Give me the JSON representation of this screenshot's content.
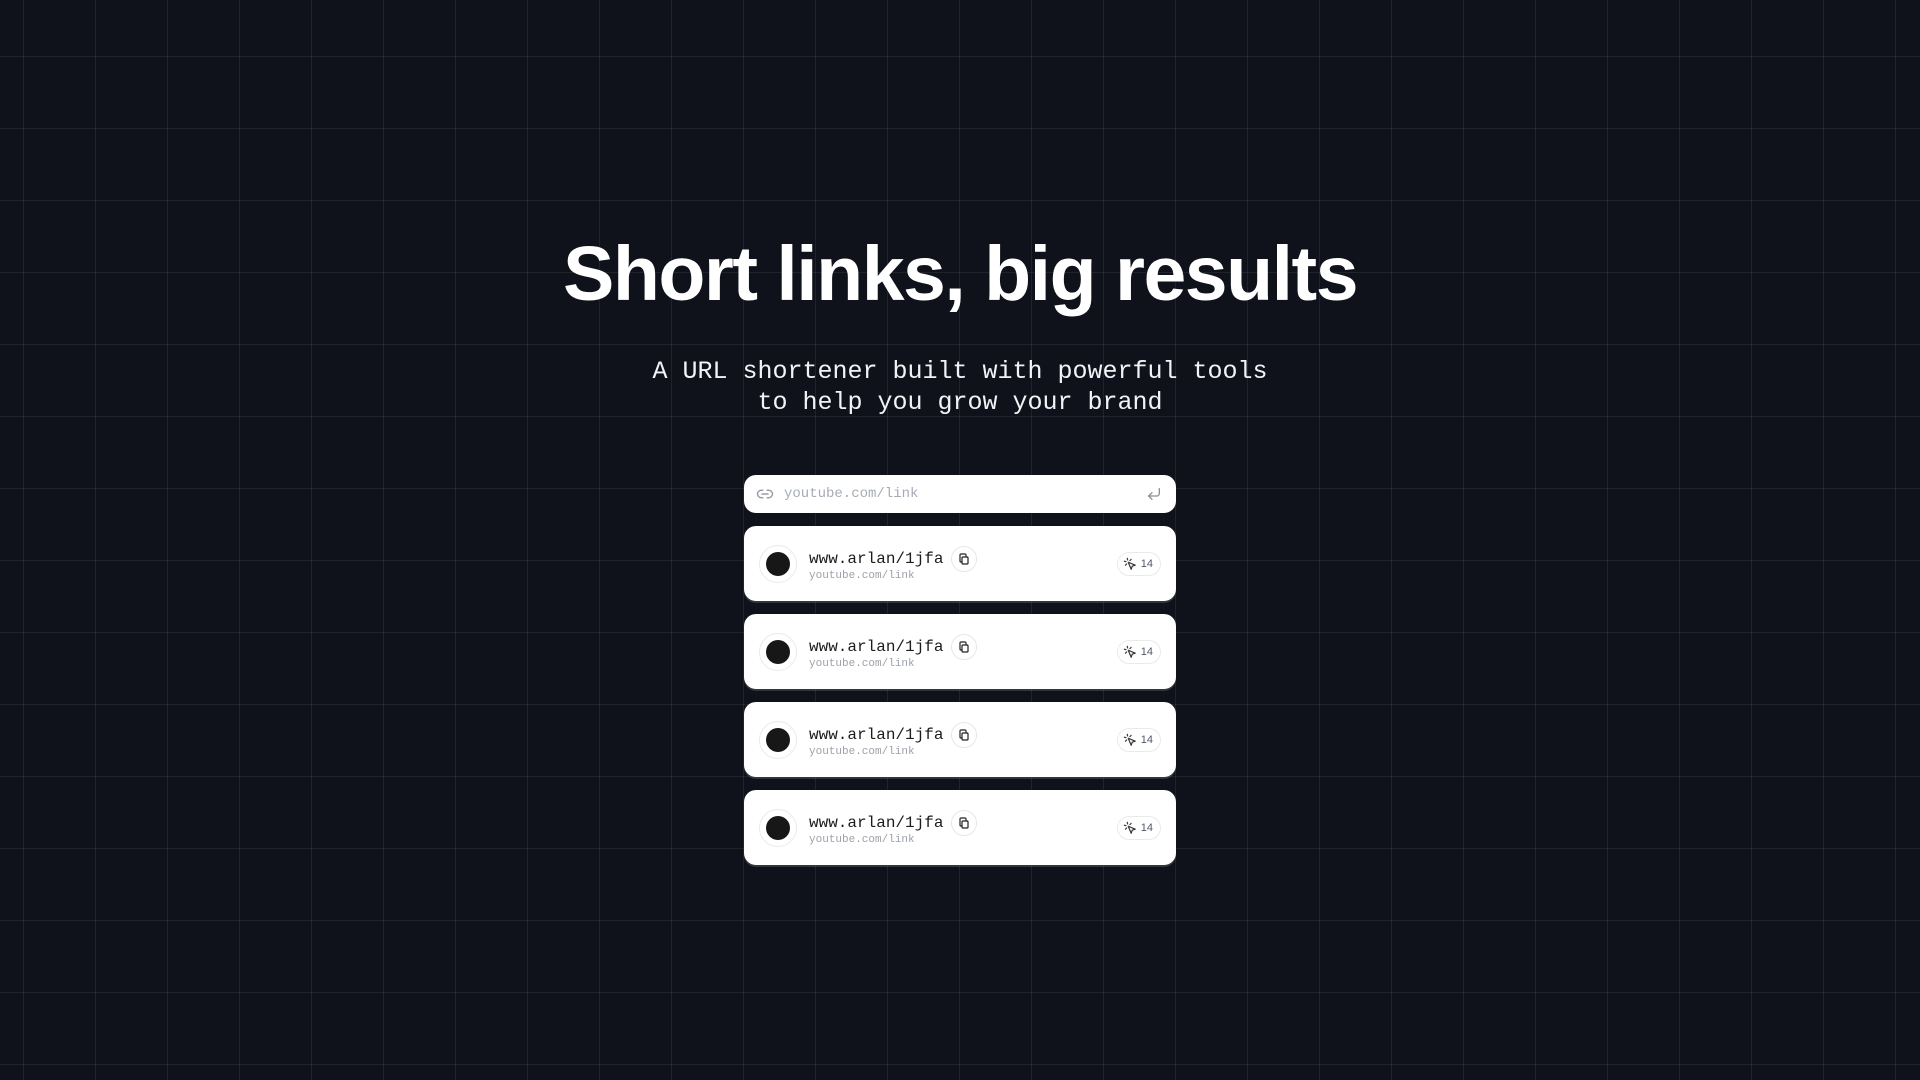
{
  "hero": {
    "title": "Short links, big results",
    "subtitle_line1": "A URL shortener built with powerful tools",
    "subtitle_line2": "to help you grow your brand"
  },
  "input": {
    "placeholder": "youtube.com/link",
    "value": "",
    "leading_icon": "link-icon",
    "trailing_icon": "enter-return-icon"
  },
  "links": [
    {
      "short_url": "www.arlan/1jfa",
      "original_url": "youtube.com/link",
      "clicks": "14"
    },
    {
      "short_url": "www.arlan/1jfa",
      "original_url": "youtube.com/link",
      "clicks": "14"
    },
    {
      "short_url": "www.arlan/1jfa",
      "original_url": "youtube.com/link",
      "clicks": "14"
    },
    {
      "short_url": "www.arlan/1jfa",
      "original_url": "youtube.com/link",
      "clicks": "14"
    }
  ],
  "icons": {
    "copy": "copy-icon",
    "clicks": "cursor-click-icon",
    "avatar": "favicon-avatar"
  },
  "colors": {
    "background": "#0f121a",
    "card": "#ffffff",
    "text_primary": "#1c1c1c",
    "text_muted": "#9ca1a9",
    "avatar_dot": "#171717"
  }
}
